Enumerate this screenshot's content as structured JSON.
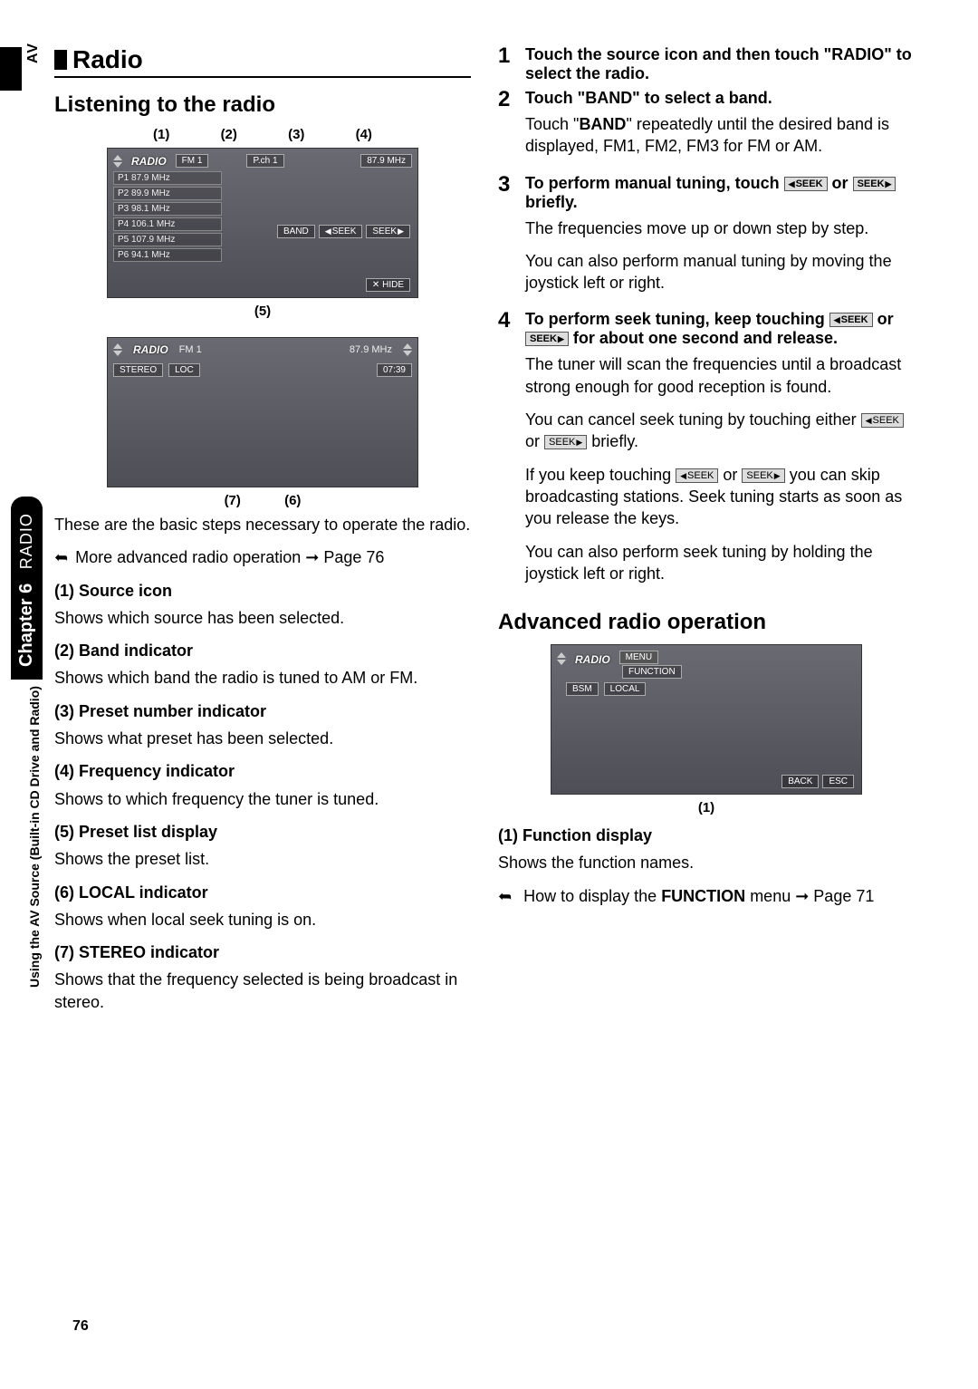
{
  "sidebar": {
    "av": "AV",
    "chapter_label": "Chapter 6",
    "chapter_section": "RADIO",
    "long": "Using the AV Source (Built-in CD Drive and Radio)"
  },
  "left": {
    "title": "Radio",
    "h2": "Listening to the radio",
    "callouts_top": [
      "(1)",
      "(2)",
      "(3)",
      "(4)"
    ],
    "callouts_mid": "(5)",
    "callouts_bottom": [
      "(7)",
      "(6)"
    ],
    "screen1": {
      "source": "RADIO",
      "band": "FM 1",
      "preset_ch": "P.ch 1",
      "freq": "87.9 MHz",
      "presets": [
        "P1  87.9 MHz",
        "P2  89.9 MHz",
        "P3  98.1 MHz",
        "P4  106.1 MHz",
        "P5  107.9 MHz",
        "P6  94.1 MHz"
      ],
      "band_btn": "BAND",
      "seek_l": "SEEK",
      "seek_r": "SEEK",
      "hide": "HIDE"
    },
    "screen2": {
      "source": "RADIO",
      "band": "FM 1",
      "freq": "87.9 MHz",
      "stereo": "STEREO",
      "loc": "LOC",
      "time": "07:39"
    },
    "intro": "These are the basic steps necessary to operate the radio.",
    "note": "More advanced radio operation ➞ Page 76",
    "items": [
      {
        "h": "(1) Source icon",
        "p": "Shows which source has been selected."
      },
      {
        "h": "(2) Band indicator",
        "p": "Shows which band the radio is tuned to AM or FM."
      },
      {
        "h": "(3) Preset number indicator",
        "p": "Shows what preset has been selected."
      },
      {
        "h": "(4) Frequency indicator",
        "p": "Shows to which frequency the tuner is tuned."
      },
      {
        "h": "(5) Preset list display",
        "p": "Shows the preset list."
      },
      {
        "h": "(6) LOCAL indicator",
        "p": "Shows when local seek tuning is on."
      },
      {
        "h": "(7) STEREO indicator",
        "p": "Shows that the frequency selected is being broadcast in stereo."
      }
    ]
  },
  "right": {
    "steps": [
      {
        "n": "1",
        "lead": "Touch the source icon and then touch \"RADIO\" to select the radio."
      },
      {
        "n": "2",
        "lead": "Touch \"BAND\" to select a band.",
        "p1a": "Touch \"",
        "p1b": "BAND",
        "p1c": "\" repeatedly until the desired band is displayed, FM1, FM2, FM3 for FM or AM."
      },
      {
        "n": "3",
        "lead_a": "To perform manual tuning, touch ",
        "lead_b": " or ",
        "lead_c": " briefly.",
        "p1": "The frequencies move up or down step by step.",
        "p2": "You can also perform manual tuning by moving the joystick left or right."
      },
      {
        "n": "4",
        "lead_a": "To perform seek tuning, keep touching ",
        "lead_b": " or ",
        "lead_c": " for about one second and release.",
        "p1": "The tuner will scan the frequencies until a broadcast strong enough for good reception is found.",
        "p2a": "You can cancel seek tuning by touching either ",
        "p2b": " or ",
        "p2c": " briefly.",
        "p3a": "If you keep touching ",
        "p3b": " or ",
        "p3c": " you can skip broadcasting stations. Seek tuning starts as soon as you release the keys.",
        "p4": "You can also perform seek tuning by holding the joystick left or right."
      }
    ],
    "seek_label": "SEEK",
    "h2": "Advanced radio operation",
    "screen3": {
      "source": "RADIO",
      "tab_menu": "MENU",
      "tab_func": "FUNCTION",
      "bsm": "BSM",
      "local": "LOCAL",
      "back": "BACK",
      "esc": "ESC"
    },
    "callout": "(1)",
    "func_h": "(1) Function display",
    "func_p": "Shows the function names.",
    "note_a": "How to display the ",
    "note_b": "FUNCTION",
    "note_c": " menu ➞ Page 71"
  },
  "page": "76"
}
